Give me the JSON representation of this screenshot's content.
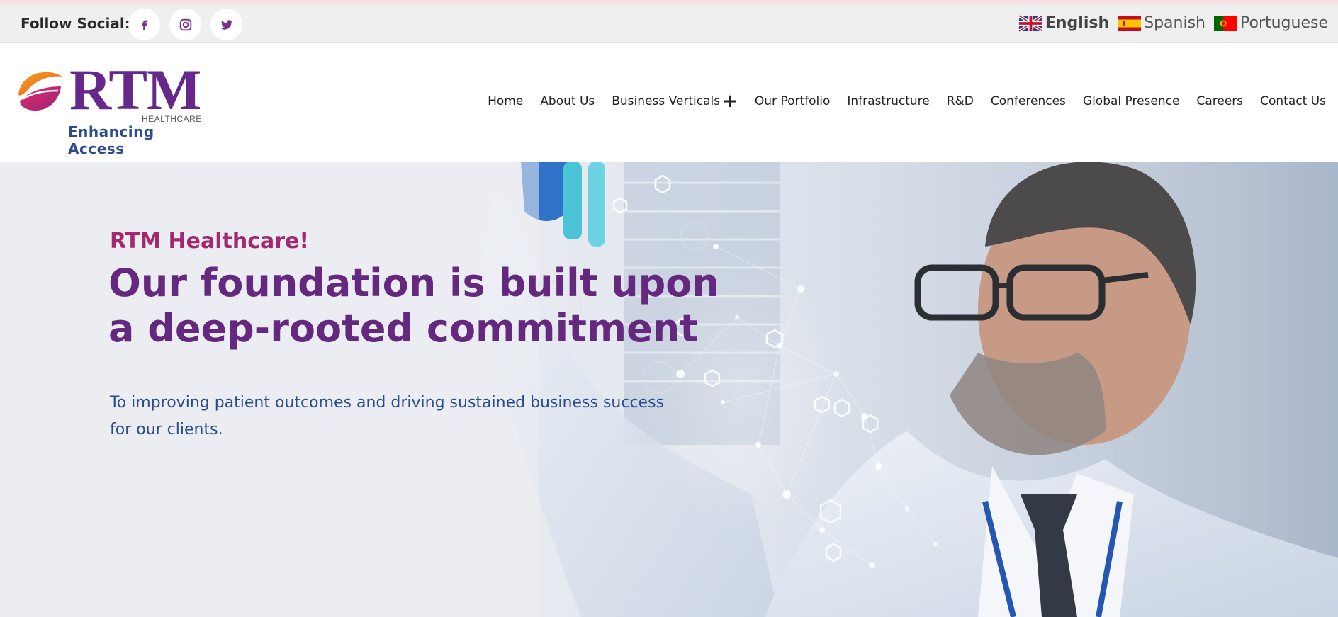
{
  "topbar": {
    "follow_label": "Follow Social:",
    "social": [
      {
        "icon": "facebook-icon"
      },
      {
        "icon": "instagram-icon"
      },
      {
        "icon": "twitter-icon"
      }
    ],
    "languages": [
      {
        "label": "English",
        "flag": "uk-flag-icon",
        "active": true
      },
      {
        "label": "Spanish",
        "flag": "spain-flag-icon",
        "active": false
      },
      {
        "label": "Portuguese",
        "flag": "portugal-flag-icon",
        "active": false
      }
    ]
  },
  "logo": {
    "brand": "RTM",
    "sub": "HEALTHCARE",
    "tagline": "Enhancing Access"
  },
  "nav": {
    "items": [
      "Home",
      "About Us",
      "Business Verticals",
      "Our Portfolio",
      "Infrastructure",
      "R&D",
      "Conferences",
      "Global Presence",
      "Careers",
      "Contact Us"
    ],
    "expand_symbol": "+"
  },
  "hero": {
    "kicker": "RTM Healthcare!",
    "headline": "Our foundation is built upon a deep-rooted commitment",
    "subtext": "To improving patient outcomes and driving sustained business success for our clients."
  },
  "colors": {
    "purple": "#65287f",
    "magenta": "#a3296c",
    "blue": "#294d8e",
    "icon_purple": "#7a2f8e"
  }
}
